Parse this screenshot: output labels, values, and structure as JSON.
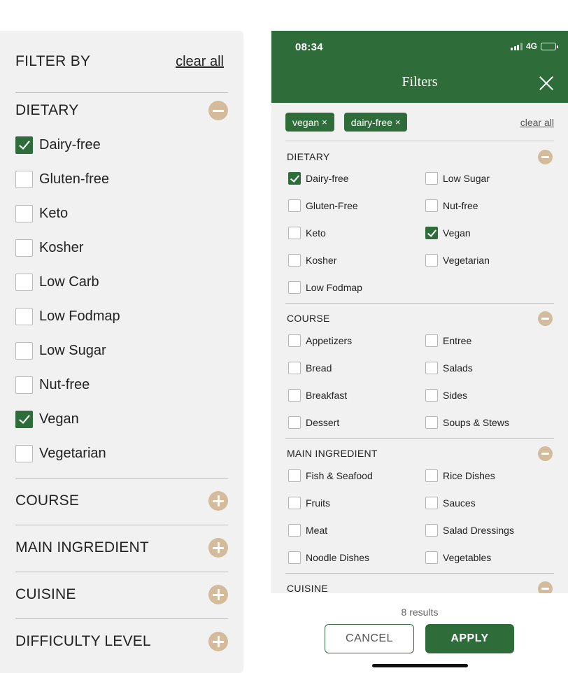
{
  "desktop": {
    "title": "FILTER BY",
    "clear_all": "clear all",
    "dietary": {
      "label": "DIETARY",
      "options": [
        {
          "label": "Dairy-free",
          "checked": true
        },
        {
          "label": "Gluten-free",
          "checked": false
        },
        {
          "label": "Keto",
          "checked": false
        },
        {
          "label": "Kosher",
          "checked": false
        },
        {
          "label": "Low Carb",
          "checked": false
        },
        {
          "label": "Low Fodmap",
          "checked": false
        },
        {
          "label": "Low Sugar",
          "checked": false
        },
        {
          "label": "Nut-free",
          "checked": false
        },
        {
          "label": "Vegan",
          "checked": true
        },
        {
          "label": "Vegetarian",
          "checked": false
        }
      ]
    },
    "collapsed_sections": [
      "COURSE",
      "MAIN INGREDIENT",
      "CUISINE",
      "DIFFICULTY LEVEL"
    ]
  },
  "mobile": {
    "status_time": "08:34",
    "network": "4G",
    "title": "Filters",
    "chips": [
      "vegan",
      "dairy-free"
    ],
    "chip_remove": "×",
    "clear_all": "clear all",
    "sections": [
      {
        "label": "DIETARY",
        "options": [
          {
            "label": "Dairy-free",
            "checked": true
          },
          {
            "label": "Low Sugar",
            "checked": false
          },
          {
            "label": "Gluten-Free",
            "checked": false
          },
          {
            "label": "Nut-free",
            "checked": false
          },
          {
            "label": "Keto",
            "checked": false
          },
          {
            "label": "Vegan",
            "checked": true
          },
          {
            "label": "Kosher",
            "checked": false
          },
          {
            "label": "Vegetarian",
            "checked": false
          },
          {
            "label": "Low Fodmap",
            "checked": false
          }
        ]
      },
      {
        "label": "COURSE",
        "options": [
          {
            "label": "Appetizers",
            "checked": false
          },
          {
            "label": "Entree",
            "checked": false
          },
          {
            "label": "Bread",
            "checked": false
          },
          {
            "label": "Salads",
            "checked": false
          },
          {
            "label": "Breakfast",
            "checked": false
          },
          {
            "label": "Sides",
            "checked": false
          },
          {
            "label": "Dessert",
            "checked": false
          },
          {
            "label": "Soups & Stews",
            "checked": false
          }
        ]
      },
      {
        "label": "MAIN INGREDIENT",
        "options": [
          {
            "label": "Fish & Seafood",
            "checked": false
          },
          {
            "label": "Rice Dishes",
            "checked": false
          },
          {
            "label": "Fruits",
            "checked": false
          },
          {
            "label": "Sauces",
            "checked": false
          },
          {
            "label": "Meat",
            "checked": false
          },
          {
            "label": "Salad Dressings",
            "checked": false
          },
          {
            "label": "Noodle Dishes",
            "checked": false
          },
          {
            "label": "Vegetables",
            "checked": false
          }
        ]
      },
      {
        "label": "CUISINE",
        "options": []
      }
    ],
    "results": "8 results",
    "cancel_label": "CANCEL",
    "apply_label": "APPLY"
  },
  "colors": {
    "brand_green": "#2e6d3a",
    "accent_tan": "#d4bb9b",
    "panel_gray": "#f1f1f1"
  }
}
